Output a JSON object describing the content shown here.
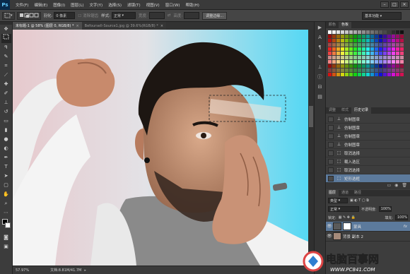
{
  "menubar": {
    "logo": "Ps",
    "items": [
      "文件(F)",
      "编辑(E)",
      "图像(I)",
      "图层(L)",
      "文字(Y)",
      "选择(S)",
      "滤镜(T)",
      "视图(V)",
      "窗口(W)",
      "帮助(H)"
    ],
    "window_controls": [
      "–",
      "□",
      "×"
    ]
  },
  "options": {
    "feather_label": "羽化:",
    "feather_value": "0 像素",
    "antialias_label": "消除锯齿",
    "style_label": "样式:",
    "style_value": "正常",
    "width_label": "宽度:",
    "height_label": "高度:",
    "refine_button": "调整边缘...",
    "workspace": "基本功能"
  },
  "tabs": [
    {
      "label": "未标题-1 @ 58% (图层 0, RGB/8) *",
      "active": true
    },
    {
      "label": "Befoursell-Source1.jpg @ 39.6%(RGB/8) *",
      "active": false
    }
  ],
  "status": {
    "zoom": "57.97%",
    "doc": "文档:8.81M/41.7M"
  },
  "panels": {
    "color_tabs": [
      "颜色",
      "色板"
    ],
    "history_tabs": [
      "调整",
      "样式",
      "历史记录"
    ],
    "history": [
      {
        "label": "仿制图章",
        "icon": "stamp-icon"
      },
      {
        "label": "仿制图章",
        "icon": "stamp-icon"
      },
      {
        "label": "仿制图章",
        "icon": "stamp-icon"
      },
      {
        "label": "仿制图章",
        "icon": "stamp-icon"
      },
      {
        "label": "取消选择",
        "icon": "selection-icon"
      },
      {
        "label": "载入选区",
        "icon": "selection-icon"
      },
      {
        "label": "取消选择",
        "icon": "selection-icon"
      },
      {
        "label": "矩形选框",
        "icon": "marquee-icon"
      }
    ],
    "layers_tabs": [
      "图层",
      "通道",
      "路径"
    ],
    "blend_mode": "正常",
    "opacity_label": "不透明度:",
    "opacity_value": "100%",
    "lock_label": "锁定:",
    "fill_label": "填充:",
    "fill_value": "100%",
    "kind_label": "类型",
    "layers": [
      {
        "name": "蒙具",
        "selected": true,
        "fx": "fx"
      },
      {
        "name": "背景 副本 2",
        "selected": false,
        "fx": ""
      }
    ]
  },
  "watermark": {
    "brand": "电脑百事网",
    "url": "WWW.PC841.COM"
  },
  "colors": {
    "accent": "#5c7a9c",
    "panel_bg": "#3d3d3d",
    "canvas_bg_start": "#e8c8cc",
    "canvas_bg_end": "#5fd9f2"
  }
}
